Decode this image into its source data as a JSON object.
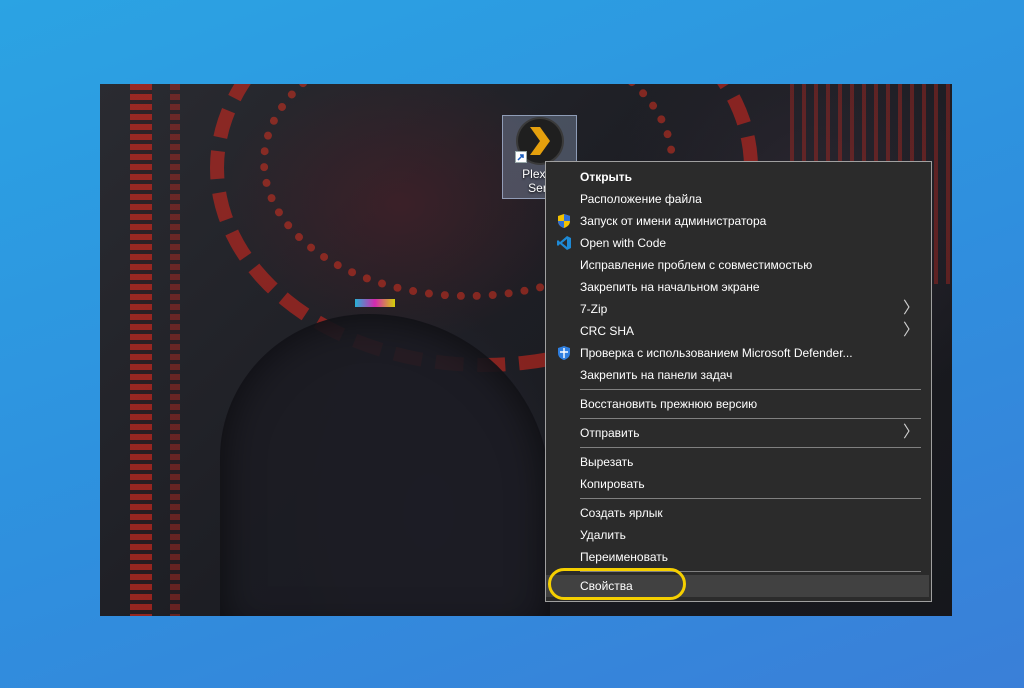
{
  "desktop_icon": {
    "label": "Plex M\nServ",
    "colors": {
      "logo_bg": "#1f1f1f",
      "logo_chevron": "#e5a00d"
    }
  },
  "context_menu": {
    "items": [
      {
        "label": "Открыть",
        "bold": true
      },
      {
        "label": "Расположение файла"
      },
      {
        "label": "Запуск от имени администратора",
        "icon": "uac-shield-icon"
      },
      {
        "label": "Open with Code",
        "icon": "vscode-icon"
      },
      {
        "label": "Исправление проблем с совместимостью"
      },
      {
        "label": "Закрепить на начальном экране"
      },
      {
        "label": "7-Zip",
        "submenu": true
      },
      {
        "label": "CRC SHA",
        "submenu": true
      },
      {
        "label": "Проверка с использованием Microsoft Defender...",
        "icon": "defender-icon"
      },
      {
        "label": "Закрепить на панели задач"
      },
      {
        "label": "Восстановить прежнюю версию"
      },
      {
        "label": "Отправить",
        "submenu": true
      },
      {
        "label": "Вырезать"
      },
      {
        "label": "Копировать"
      },
      {
        "label": "Создать ярлык"
      },
      {
        "label": "Удалить"
      },
      {
        "label": "Переименовать"
      },
      {
        "label": "Свойства",
        "hovered": true
      }
    ],
    "submenu_glyph": "〉"
  },
  "colors": {
    "frame_bg": "#2f94df",
    "menu_bg": "#2b2b2b",
    "menu_border": "#a0a0a0",
    "menu_hover": "#414141",
    "highlight_ring": "#f5cf00"
  }
}
